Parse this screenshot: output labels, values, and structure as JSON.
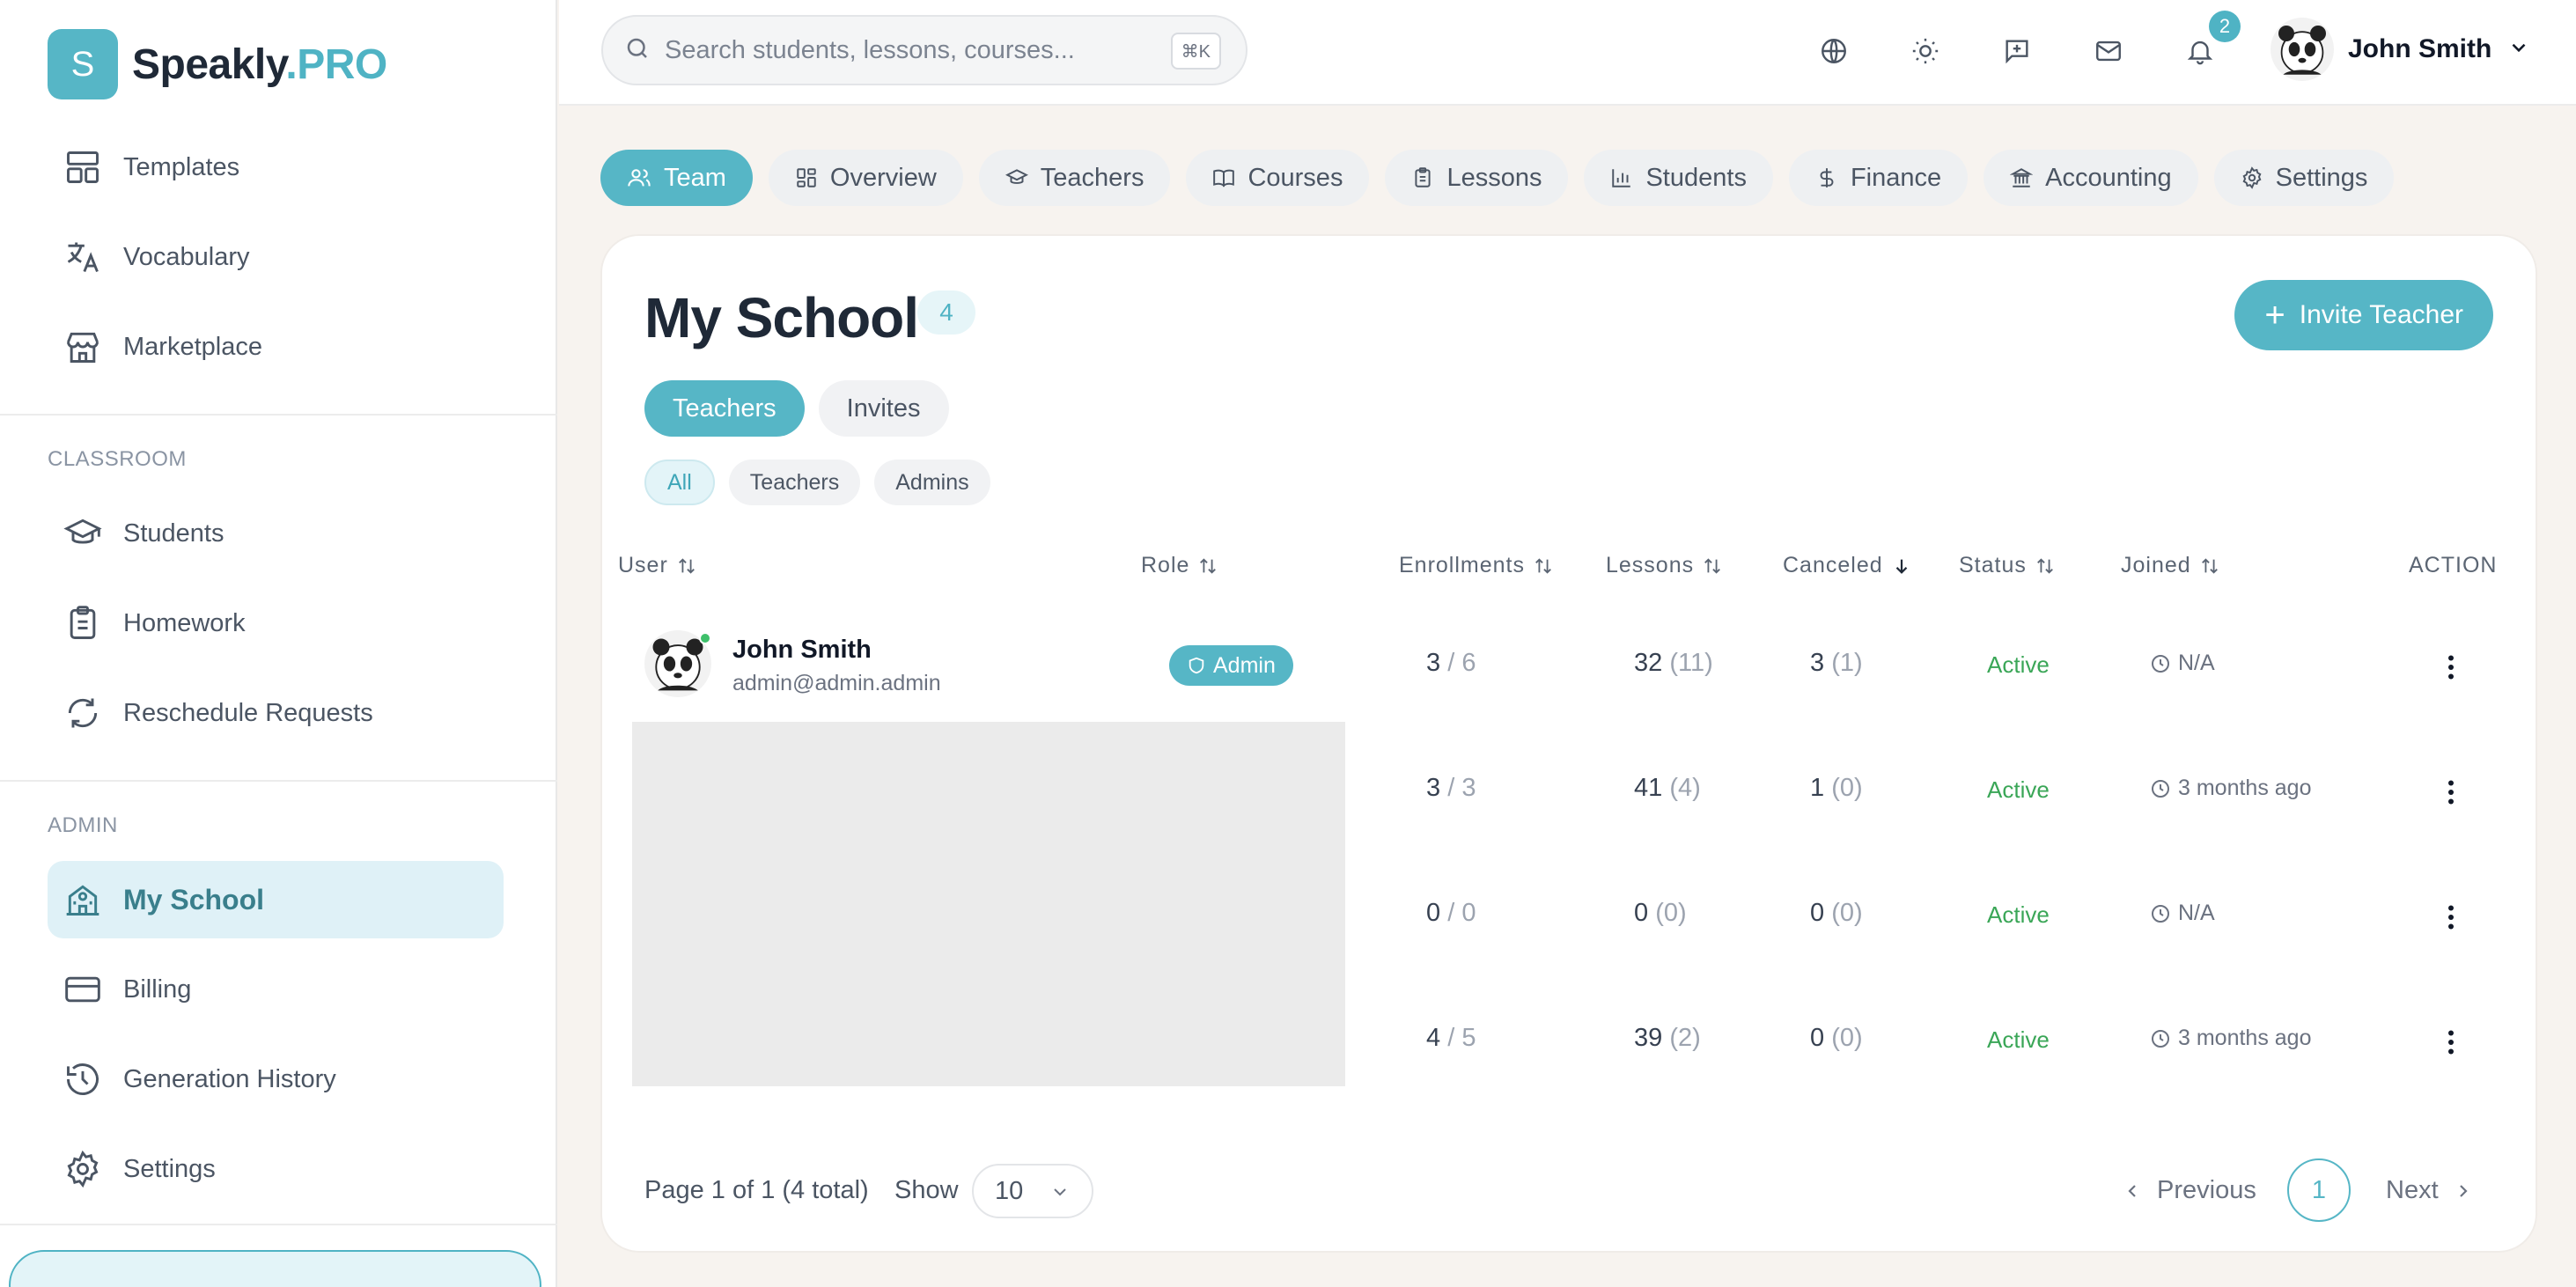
{
  "brand": {
    "letter": "S",
    "name_a": "Speakly",
    "name_b": ".PRO"
  },
  "sidebar": {
    "items_top": [
      {
        "label": "Templates",
        "icon": "layout-icon"
      },
      {
        "label": "Vocabulary",
        "icon": "translate-icon"
      },
      {
        "label": "Marketplace",
        "icon": "store-icon"
      }
    ],
    "classroom_label": "CLASSROOM",
    "items_classroom": [
      {
        "label": "Students",
        "icon": "graduation-cap-icon"
      },
      {
        "label": "Homework",
        "icon": "clipboard-icon"
      },
      {
        "label": "Reschedule Requests",
        "icon": "refresh-icon"
      }
    ],
    "admin_label": "ADMIN",
    "items_admin": [
      {
        "label": "My School",
        "icon": "school-icon",
        "active": true
      },
      {
        "label": "Billing",
        "icon": "credit-card-icon"
      },
      {
        "label": "Generation History",
        "icon": "history-icon"
      },
      {
        "label": "Settings",
        "icon": "gear-icon"
      }
    ]
  },
  "topbar": {
    "search_placeholder": "Search students, lessons, courses...",
    "shortcut": "⌘K",
    "notification_count": "2",
    "user_name": "John Smith"
  },
  "tabs": [
    {
      "label": "Team",
      "active": true
    },
    {
      "label": "Overview"
    },
    {
      "label": "Teachers"
    },
    {
      "label": "Courses"
    },
    {
      "label": "Lessons"
    },
    {
      "label": "Students"
    },
    {
      "label": "Finance"
    },
    {
      "label": "Accounting"
    },
    {
      "label": "Settings"
    }
  ],
  "page": {
    "title": "My School",
    "count": "4",
    "invite_label": "Invite Teacher",
    "subtabs": [
      "Teachers",
      "Invites"
    ],
    "filters": [
      "All",
      "Teachers",
      "Admins"
    ]
  },
  "table": {
    "headers": {
      "user": "User",
      "role": "Role",
      "enrollments": "Enrollments",
      "lessons": "Lessons",
      "canceled": "Canceled",
      "status": "Status",
      "joined": "Joined",
      "action": "ACTION"
    },
    "rows": [
      {
        "name": "John Smith",
        "email": "admin@admin.admin",
        "role": "Admin",
        "enroll_a": "3",
        "enroll_b": "/ 6",
        "lessons_a": "32",
        "lessons_b": "(11)",
        "canceled_a": "3",
        "canceled_b": "(1)",
        "status": "Active",
        "joined": "N/A"
      },
      {
        "enroll_a": "3",
        "enroll_b": "/ 3",
        "lessons_a": "41",
        "lessons_b": "(4)",
        "canceled_a": "1",
        "canceled_b": "(0)",
        "status": "Active",
        "joined": "3 months ago"
      },
      {
        "enroll_a": "0",
        "enroll_b": "/ 0",
        "lessons_a": "0",
        "lessons_b": "(0)",
        "canceled_a": "0",
        "canceled_b": "(0)",
        "status": "Active",
        "joined": "N/A"
      },
      {
        "enroll_a": "4",
        "enroll_b": "/ 5",
        "lessons_a": "39",
        "lessons_b": "(2)",
        "canceled_a": "0",
        "canceled_b": "(0)",
        "status": "Active",
        "joined": "3 months ago"
      }
    ]
  },
  "pagination": {
    "summary": "Page 1 of 1 (4 total)",
    "show_label": "Show",
    "page_size": "10",
    "previous": "Previous",
    "current": "1",
    "next": "Next"
  },
  "colors": {
    "accent": "#56b6c6",
    "active_status": "#3aa657"
  }
}
